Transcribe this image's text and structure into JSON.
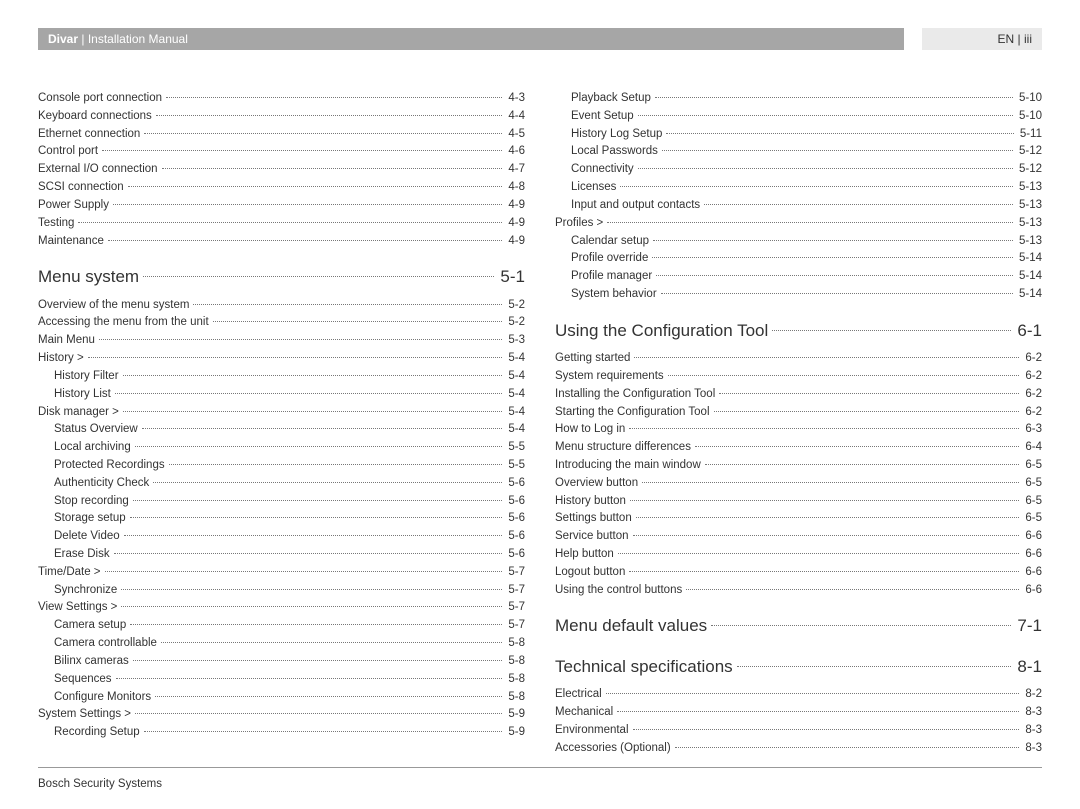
{
  "header": {
    "brand": "Divar",
    "separator": " | ",
    "title": "Installation Manual",
    "right": "EN | iii"
  },
  "footer": {
    "company": "Bosch Security Systems"
  },
  "toc": {
    "left": [
      {
        "type": "item",
        "label": "Console port connection",
        "page": "4-3",
        "indent": 0
      },
      {
        "type": "item",
        "label": "Keyboard connections",
        "page": "4-4",
        "indent": 0
      },
      {
        "type": "item",
        "label": "Ethernet connection",
        "page": "4-5",
        "indent": 0
      },
      {
        "type": "item",
        "label": "Control port",
        "page": "4-6",
        "indent": 0
      },
      {
        "type": "item",
        "label": "External I/O connection",
        "page": "4-7",
        "indent": 0
      },
      {
        "type": "item",
        "label": "SCSI connection",
        "page": "4-8",
        "indent": 0
      },
      {
        "type": "item",
        "label": "Power Supply",
        "page": "4-9",
        "indent": 0
      },
      {
        "type": "item",
        "label": "Testing",
        "page": "4-9",
        "indent": 0
      },
      {
        "type": "item",
        "label": "Maintenance",
        "page": "4-9",
        "indent": 0
      },
      {
        "type": "chapter",
        "label": "Menu system",
        "page": "5-1"
      },
      {
        "type": "item",
        "label": "Overview of the menu system",
        "page": "5-2",
        "indent": 0
      },
      {
        "type": "item",
        "label": "Accessing the menu from the unit",
        "page": "5-2",
        "indent": 0
      },
      {
        "type": "item",
        "label": "Main Menu",
        "page": "5-3",
        "indent": 0
      },
      {
        "type": "item",
        "label": "History >",
        "page": "5-4",
        "indent": 0
      },
      {
        "type": "item",
        "label": "History Filter",
        "page": "5-4",
        "indent": 1
      },
      {
        "type": "item",
        "label": "History List",
        "page": "5-4",
        "indent": 1
      },
      {
        "type": "item",
        "label": "Disk manager >",
        "page": "5-4",
        "indent": 0
      },
      {
        "type": "item",
        "label": "Status Overview",
        "page": "5-4",
        "indent": 1
      },
      {
        "type": "item",
        "label": "Local archiving",
        "page": "5-5",
        "indent": 1
      },
      {
        "type": "item",
        "label": "Protected Recordings",
        "page": "5-5",
        "indent": 1
      },
      {
        "type": "item",
        "label": "Authenticity Check",
        "page": "5-6",
        "indent": 1
      },
      {
        "type": "item",
        "label": "Stop recording",
        "page": "5-6",
        "indent": 1
      },
      {
        "type": "item",
        "label": "Storage setup",
        "page": "5-6",
        "indent": 1
      },
      {
        "type": "item",
        "label": "Delete Video",
        "page": "5-6",
        "indent": 1
      },
      {
        "type": "item",
        "label": "Erase Disk",
        "page": "5-6",
        "indent": 1
      },
      {
        "type": "item",
        "label": "Time/Date >",
        "page": "5-7",
        "indent": 0
      },
      {
        "type": "item",
        "label": "Synchronize",
        "page": "5-7",
        "indent": 1
      },
      {
        "type": "item",
        "label": "View Settings >",
        "page": "5-7",
        "indent": 0
      },
      {
        "type": "item",
        "label": "Camera setup",
        "page": "5-7",
        "indent": 1
      },
      {
        "type": "item",
        "label": "Camera controllable",
        "page": "5-8",
        "indent": 1
      },
      {
        "type": "item",
        "label": "Bilinx cameras",
        "page": "5-8",
        "indent": 1
      },
      {
        "type": "item",
        "label": "Sequences",
        "page": "5-8",
        "indent": 1
      },
      {
        "type": "item",
        "label": "Configure Monitors",
        "page": "5-8",
        "indent": 1
      },
      {
        "type": "item",
        "label": "System Settings >",
        "page": "5-9",
        "indent": 0
      },
      {
        "type": "item",
        "label": "Recording Setup",
        "page": "5-9",
        "indent": 1
      }
    ],
    "right": [
      {
        "type": "item",
        "label": "Playback Setup",
        "page": "5-10",
        "indent": 1
      },
      {
        "type": "item",
        "label": "Event Setup",
        "page": "5-10",
        "indent": 1
      },
      {
        "type": "item",
        "label": "History Log Setup",
        "page": "5-11",
        "indent": 1
      },
      {
        "type": "item",
        "label": "Local Passwords",
        "page": "5-12",
        "indent": 1
      },
      {
        "type": "item",
        "label": "Connectivity",
        "page": "5-12",
        "indent": 1
      },
      {
        "type": "item",
        "label": "Licenses",
        "page": "5-13",
        "indent": 1
      },
      {
        "type": "item",
        "label": "Input and output contacts",
        "page": "5-13",
        "indent": 1
      },
      {
        "type": "item",
        "label": "Profiles >",
        "page": "5-13",
        "indent": 0
      },
      {
        "type": "item",
        "label": "Calendar setup",
        "page": "5-13",
        "indent": 1
      },
      {
        "type": "item",
        "label": "Profile override",
        "page": "5-14",
        "indent": 1
      },
      {
        "type": "item",
        "label": "Profile manager",
        "page": "5-14",
        "indent": 1
      },
      {
        "type": "item",
        "label": "System behavior",
        "page": "5-14",
        "indent": 1
      },
      {
        "type": "chapter",
        "label": "Using the Configuration Tool",
        "page": "6-1"
      },
      {
        "type": "item",
        "label": "Getting started",
        "page": "6-2",
        "indent": 0
      },
      {
        "type": "item",
        "label": "System requirements",
        "page": "6-2",
        "indent": 0
      },
      {
        "type": "item",
        "label": "Installing the Configuration Tool",
        "page": "6-2",
        "indent": 0
      },
      {
        "type": "item",
        "label": "Starting the Configuration Tool",
        "page": "6-2",
        "indent": 0
      },
      {
        "type": "item",
        "label": "How to Log in",
        "page": "6-3",
        "indent": 0
      },
      {
        "type": "item",
        "label": "Menu structure differences",
        "page": "6-4",
        "indent": 0
      },
      {
        "type": "item",
        "label": "Introducing the main window",
        "page": "6-5",
        "indent": 0
      },
      {
        "type": "item",
        "label": "Overview button",
        "page": "6-5",
        "indent": 0
      },
      {
        "type": "item",
        "label": "History button",
        "page": "6-5",
        "indent": 0
      },
      {
        "type": "item",
        "label": "Settings button",
        "page": "6-5",
        "indent": 0
      },
      {
        "type": "item",
        "label": "Service button",
        "page": "6-6",
        "indent": 0
      },
      {
        "type": "item",
        "label": "Help button",
        "page": "6-6",
        "indent": 0
      },
      {
        "type": "item",
        "label": "Logout button",
        "page": "6-6",
        "indent": 0
      },
      {
        "type": "item",
        "label": "Using the control buttons",
        "page": "6-6",
        "indent": 0
      },
      {
        "type": "chapter",
        "label": "Menu default values",
        "page": "7-1"
      },
      {
        "type": "chapter",
        "label": "Technical specifications",
        "page": "8-1"
      },
      {
        "type": "item",
        "label": "Electrical",
        "page": "8-2",
        "indent": 0
      },
      {
        "type": "item",
        "label": "Mechanical",
        "page": "8-3",
        "indent": 0
      },
      {
        "type": "item",
        "label": "Environmental",
        "page": "8-3",
        "indent": 0
      },
      {
        "type": "item",
        "label": "Accessories (Optional)",
        "page": "8-3",
        "indent": 0
      }
    ]
  }
}
